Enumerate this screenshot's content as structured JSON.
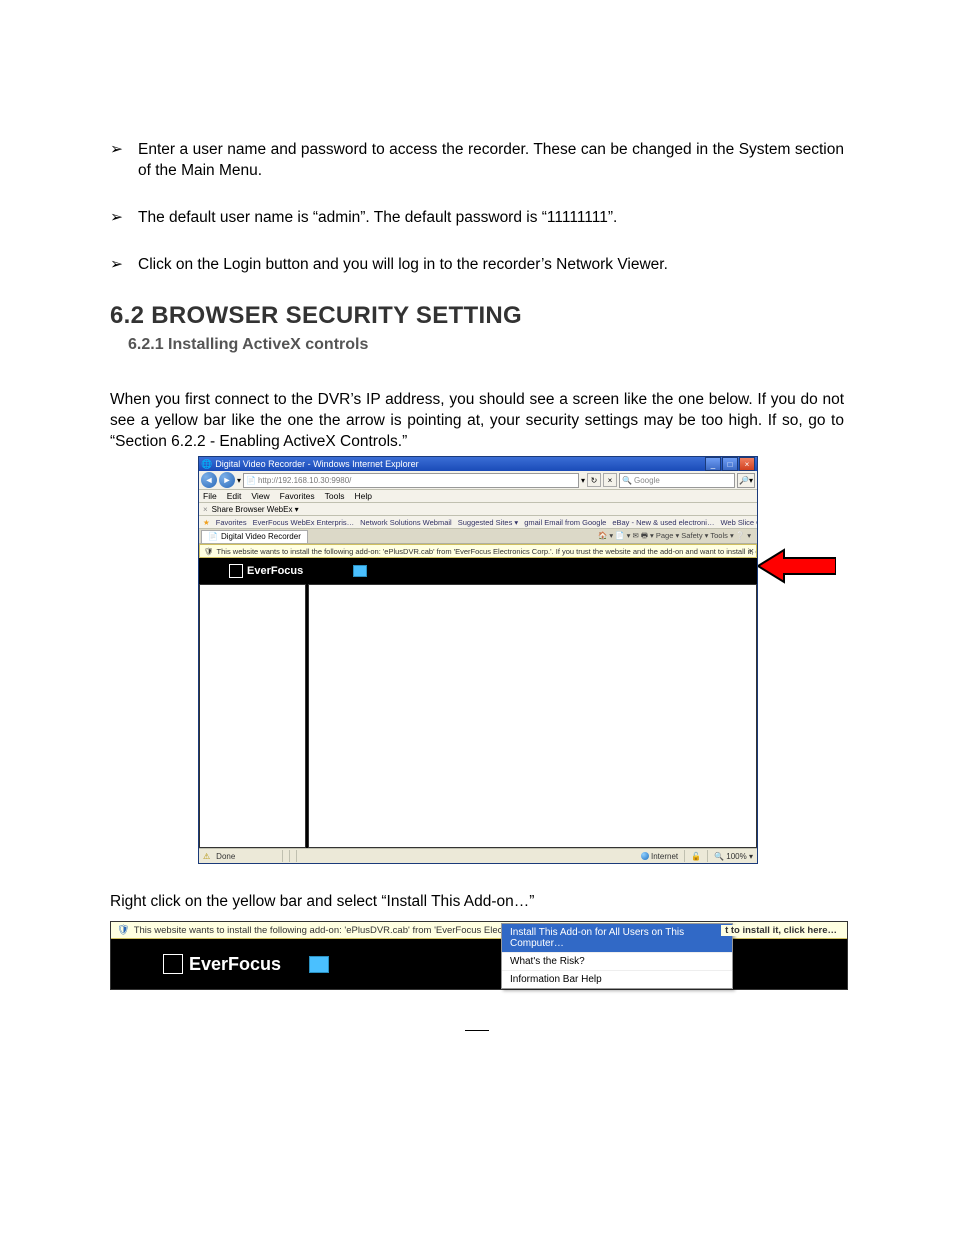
{
  "bullets": [
    "Enter a user name and password to access the recorder. These can be changed in the System section of the Main Menu.",
    "The default user name is “admin”. The default password is “11111111”.",
    "Click on the Login button and you will log in to the recorder’s Network Viewer."
  ],
  "h2": "6.2  BROWSER SECURITY SETTING",
  "h3": "6.2.1 Installing ActiveX controls",
  "paragraph1": "When you first connect to the DVR’s IP address, you should see a screen like the one below. If you do not see a yellow bar like the one the arrow is pointing at, your security settings may be too high. If so, go to “Section 6.2.2 - Enabling ActiveX Controls.”",
  "paragraph2": "Right click on the yellow bar and select “Install This Add-on…”",
  "ie": {
    "title": "Digital Video Recorder - Windows Internet Explorer",
    "address": "http://192.168.10.30:9980/",
    "searchPlaceholder": "Google",
    "menus": [
      "File",
      "Edit",
      "View",
      "Favorites",
      "Tools",
      "Help"
    ],
    "share": "Share Browser   WebEx ▾",
    "favLabel": "Favorites",
    "favItems": [
      "EverFocus WebEx Enterpris…",
      "Network Solutions Webmail",
      "Suggested Sites ▾",
      "gmail Email from Google",
      "eBay - New & used electroni…",
      "Web Slice Gallery ▾"
    ],
    "tab": "Digital Video Recorder",
    "tabRight": "🏠 ▾  📄 ▾  ✉  🖶 ▾  Page ▾  Safety ▾  Tools ▾  ❔ ▾",
    "infobar": "This website wants to install the following add-on: 'ePlusDVR.cab' from 'EverFocus Electronics Corp.'. If you trust the website and the add-on and want to install it, click here…",
    "brand": "EverFocus",
    "statusDone": "Done",
    "statusZone": "Internet",
    "statusZoom": "100%"
  },
  "ie2": {
    "infobar": "This website wants to install the following add-on: 'ePlusDVR.cab' from 'EverFocus Electro",
    "infobarTail": "t to install it, click here…",
    "brand": "EverFocus",
    "menu": {
      "install": "Install This Add-on for All Users on This Computer…",
      "risk": "What's the Risk?",
      "help": "Information Bar Help"
    }
  }
}
